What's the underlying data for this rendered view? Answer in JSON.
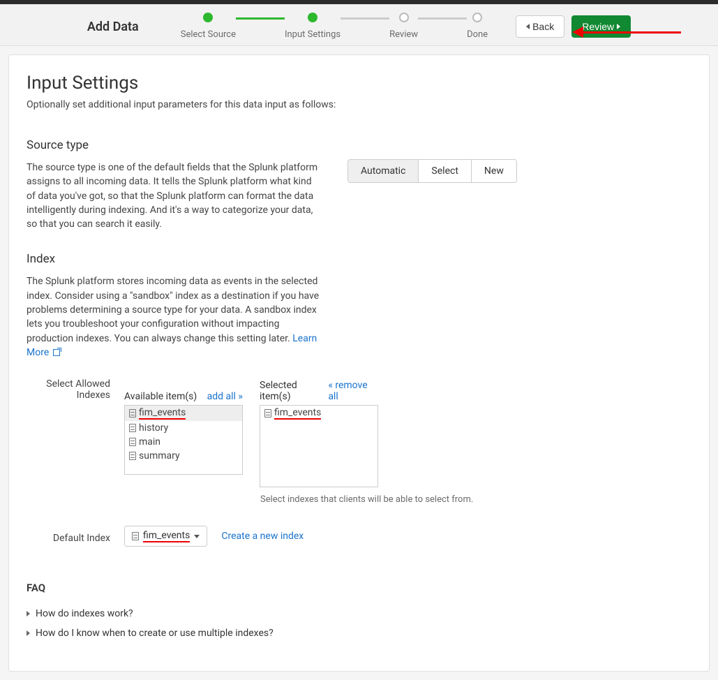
{
  "header": {
    "title": "Add Data",
    "steps": [
      {
        "label": "Select Source",
        "done": true
      },
      {
        "label": "Input Settings",
        "done": true
      },
      {
        "label": "Review",
        "done": false
      },
      {
        "label": "Done",
        "done": false
      }
    ],
    "back_label": "Back",
    "review_label": "Review"
  },
  "page": {
    "title": "Input Settings",
    "description": "Optionally set additional input parameters for this data input as follows:"
  },
  "source_type": {
    "title": "Source type",
    "description": "The source type is one of the default fields that the Splunk platform assigns to all incoming data. It tells the Splunk platform what kind of data you've got, so that the Splunk platform can format the data intelligently during indexing. And it's a way to categorize your data, so that you can search it easily.",
    "options": [
      "Automatic",
      "Select",
      "New"
    ],
    "selected": "Automatic"
  },
  "index": {
    "title": "Index",
    "description": "The Splunk platform stores incoming data as events in the selected index. Consider using a \"sandbox\" index as a destination if you have problems determining a source type for your data. A sandbox index lets you troubleshoot your configuration without impacting production indexes. You can always change this setting later.",
    "learn_more": "Learn More",
    "select_allowed_label": "Select Allowed Indexes",
    "available_label": "Available item(s)",
    "add_all_label": "add all »",
    "selected_label": "Selected item(s)",
    "remove_all_label": "« remove all",
    "available_items": [
      "fim_events",
      "history",
      "main",
      "summary"
    ],
    "selected_items": [
      "fim_events"
    ],
    "helper_text": "Select indexes that clients will be able to select from.",
    "default_index_label": "Default Index",
    "default_index_value": "fim_events",
    "create_new_label": "Create a new index"
  },
  "faq": {
    "title": "FAQ",
    "items": [
      "How do indexes work?",
      "How do I know when to create or use multiple indexes?"
    ]
  }
}
